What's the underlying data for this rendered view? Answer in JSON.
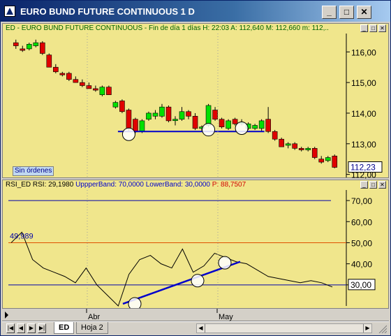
{
  "window": {
    "title": "EURO BUND FUTURE CONTINUOUS 1 D",
    "minimize_icon": "minimize-icon",
    "restore_icon": "restore-icon",
    "close_icon": "close-icon"
  },
  "price_panel": {
    "header_prefix": "ED - EURO BUND FUTURE CONTINUOUS - Fin de día 1 días  H: 22:03  A: 112,640  M: 112,660  m: 112,..",
    "orders_badge": "Sin órdenes",
    "last_price_label": "112,23",
    "y_ticks": [
      "116,00",
      "115,00",
      "114,00",
      "113,00",
      "112,00"
    ],
    "colors": {
      "background": "#f0e68c",
      "up": "#00e000",
      "down": "#e00000",
      "support": "#0000cc"
    }
  },
  "rsi_panel": {
    "header_name": "RSI_ED",
    "header_rsi": "RSI: 29,1980",
    "header_upper": "UppperBand: 70,0000",
    "header_lower": "LowerBand: 30,0000",
    "header_p": "P: 88,7507",
    "marker_label": "49,989",
    "current_label": "30,00",
    "y_ticks": [
      "70,00",
      "60,00",
      "50,00",
      "40,00",
      "30,00"
    ]
  },
  "time_axis": {
    "labels": [
      "Abr",
      "May"
    ]
  },
  "tabs": [
    {
      "label": "ED",
      "active": true
    },
    {
      "label": "Hoja 2",
      "active": false
    }
  ],
  "chart_data": [
    {
      "type": "candlestick",
      "title": "ED - EURO BUND FUTURE CONTINUOUS",
      "ylim": [
        111.9,
        116.6
      ],
      "y_ticks": [
        116,
        115,
        114,
        113,
        112
      ],
      "x_labels": [
        "Abr",
        "May"
      ],
      "support_line": 113.4,
      "candles": [
        {
          "o": 116.3,
          "h": 116.4,
          "l": 116.1,
          "c": 116.2
        },
        {
          "o": 116.1,
          "h": 116.2,
          "l": 116.0,
          "c": 116.05
        },
        {
          "o": 116.1,
          "h": 116.3,
          "l": 116.05,
          "c": 116.25
        },
        {
          "o": 116.2,
          "h": 116.4,
          "l": 116.15,
          "c": 116.3
        },
        {
          "o": 116.3,
          "h": 116.35,
          "l": 115.9,
          "c": 115.95
        },
        {
          "o": 115.9,
          "h": 115.95,
          "l": 115.5,
          "c": 115.5
        },
        {
          "o": 115.5,
          "h": 115.6,
          "l": 115.3,
          "c": 115.35
        },
        {
          "o": 115.3,
          "h": 115.35,
          "l": 115.2,
          "c": 115.25
        },
        {
          "o": 115.3,
          "h": 115.35,
          "l": 115.05,
          "c": 115.1
        },
        {
          "o": 115.1,
          "h": 115.2,
          "l": 115.0,
          "c": 115.0
        },
        {
          "o": 115.0,
          "h": 115.1,
          "l": 114.85,
          "c": 114.9
        },
        {
          "o": 114.9,
          "h": 115.0,
          "l": 114.8,
          "c": 114.8
        },
        {
          "o": 114.8,
          "h": 114.9,
          "l": 114.7,
          "c": 114.75
        },
        {
          "o": 114.6,
          "h": 114.9,
          "l": 114.55,
          "c": 114.85
        },
        {
          "o": 114.85,
          "h": 114.9,
          "l": 114.6,
          "c": 114.6
        },
        {
          "o": 114.2,
          "h": 114.4,
          "l": 114.15,
          "c": 114.35
        },
        {
          "o": 114.4,
          "h": 114.45,
          "l": 114.0,
          "c": 114.05
        },
        {
          "o": 114.1,
          "h": 114.15,
          "l": 113.4,
          "c": 113.5
        },
        {
          "o": 113.8,
          "h": 113.85,
          "l": 113.35,
          "c": 113.4
        },
        {
          "o": 113.4,
          "h": 113.8,
          "l": 113.35,
          "c": 113.75
        },
        {
          "o": 113.8,
          "h": 114.05,
          "l": 113.75,
          "c": 114.0
        },
        {
          "o": 113.9,
          "h": 114.1,
          "l": 113.8,
          "c": 114.0
        },
        {
          "o": 113.9,
          "h": 114.3,
          "l": 113.85,
          "c": 114.2
        },
        {
          "o": 114.2,
          "h": 114.25,
          "l": 113.7,
          "c": 113.75
        },
        {
          "o": 113.8,
          "h": 113.9,
          "l": 113.6,
          "c": 113.8
        },
        {
          "o": 113.8,
          "h": 114.2,
          "l": 113.75,
          "c": 114.05
        },
        {
          "o": 114.05,
          "h": 114.1,
          "l": 113.8,
          "c": 113.9
        },
        {
          "o": 113.9,
          "h": 114.0,
          "l": 113.45,
          "c": 113.5
        },
        {
          "o": 113.5,
          "h": 113.6,
          "l": 113.4,
          "c": 113.55
        },
        {
          "o": 113.6,
          "h": 114.3,
          "l": 113.55,
          "c": 114.25
        },
        {
          "o": 114.1,
          "h": 114.2,
          "l": 113.75,
          "c": 113.8
        },
        {
          "o": 113.8,
          "h": 113.85,
          "l": 113.5,
          "c": 113.55
        },
        {
          "o": 113.5,
          "h": 113.8,
          "l": 113.45,
          "c": 113.75
        },
        {
          "o": 113.8,
          "h": 113.85,
          "l": 113.6,
          "c": 113.65
        },
        {
          "o": 113.7,
          "h": 113.8,
          "l": 113.6,
          "c": 113.7
        },
        {
          "o": 113.5,
          "h": 113.7,
          "l": 113.45,
          "c": 113.65
        },
        {
          "o": 113.5,
          "h": 113.65,
          "l": 113.45,
          "c": 113.6
        },
        {
          "o": 113.5,
          "h": 113.8,
          "l": 113.4,
          "c": 113.75
        },
        {
          "o": 113.8,
          "h": 114.2,
          "l": 113.35,
          "c": 113.4
        },
        {
          "o": 113.4,
          "h": 113.45,
          "l": 113.1,
          "c": 113.15
        },
        {
          "o": 113.15,
          "h": 113.2,
          "l": 112.9,
          "c": 112.9
        },
        {
          "o": 112.95,
          "h": 113.05,
          "l": 112.85,
          "c": 113.0
        },
        {
          "o": 113.0,
          "h": 113.05,
          "l": 112.8,
          "c": 112.85
        },
        {
          "o": 112.85,
          "h": 112.9,
          "l": 112.75,
          "c": 112.8
        },
        {
          "o": 112.8,
          "h": 112.9,
          "l": 112.75,
          "c": 112.85
        },
        {
          "o": 112.85,
          "h": 112.9,
          "l": 112.5,
          "c": 112.55
        },
        {
          "o": 112.5,
          "h": 112.6,
          "l": 112.35,
          "c": 112.4
        },
        {
          "o": 112.45,
          "h": 112.6,
          "l": 112.4,
          "c": 112.55
        },
        {
          "o": 112.6,
          "h": 112.65,
          "l": 112.2,
          "c": 112.23
        }
      ]
    },
    {
      "type": "line",
      "title": "RSI_ED",
      "ylim": [
        20,
        75
      ],
      "y_ticks": [
        70,
        60,
        50,
        40,
        30
      ],
      "upper_band": 70,
      "lower_band": 30,
      "series": [
        {
          "name": "RSI",
          "values": [
            50,
            55,
            42,
            38,
            36,
            34,
            31,
            38,
            30,
            25,
            20,
            35,
            42,
            44,
            40,
            38,
            47,
            36,
            39,
            45,
            43,
            41,
            40,
            37,
            34,
            33,
            32,
            31,
            32,
            31,
            29
          ]
        }
      ]
    }
  ]
}
